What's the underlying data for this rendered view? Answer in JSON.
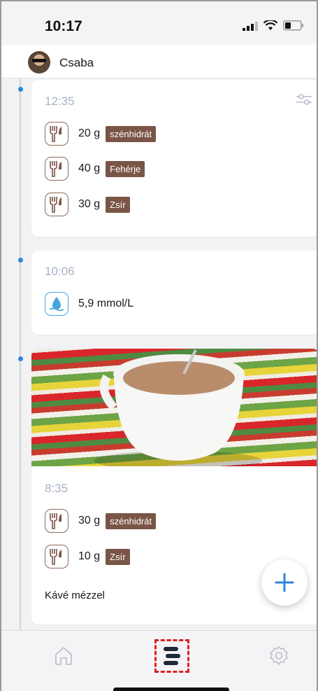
{
  "status_bar": {
    "time": "10:17"
  },
  "user": {
    "name": "Csaba"
  },
  "entries": [
    {
      "time": "12:35",
      "items": [
        {
          "amount": "20 g",
          "label": "szénhidrát"
        },
        {
          "amount": "40 g",
          "label": "Fehérje"
        },
        {
          "amount": "30 g",
          "label": "Zsír"
        }
      ]
    },
    {
      "time": "10:06",
      "glucose": "5,9 mmol/L"
    },
    {
      "time": "8:35",
      "items": [
        {
          "amount": "30 g",
          "label": "szénhidrát"
        },
        {
          "amount": "10 g",
          "label": "Zsír"
        }
      ],
      "note": "Kávé mézzel"
    }
  ],
  "colors": {
    "accent": "#2e86de",
    "badge": "#7a5546",
    "active_tab_outline": "#e02020"
  },
  "icons": [
    "home-icon",
    "list-icon",
    "settings-icon",
    "filter-icon",
    "plus-icon",
    "utensils-icon",
    "water-drop-icon"
  ]
}
